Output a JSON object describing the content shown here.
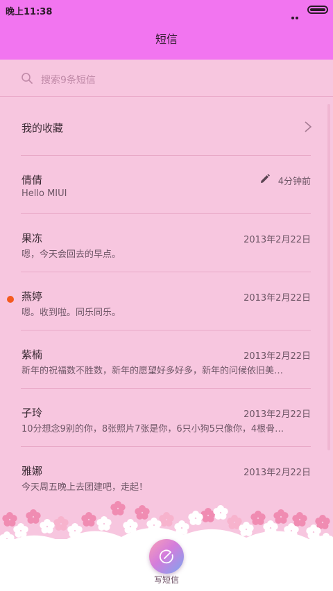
{
  "status_bar": {
    "time": "晚上11:38"
  },
  "header": {
    "title": "短信"
  },
  "search": {
    "placeholder": "搜索9条短信"
  },
  "favorites": {
    "label": "我的收藏"
  },
  "messages": [
    {
      "name": "倩倩",
      "preview": "Hello MIUI",
      "time": "4分钟前",
      "draft": true,
      "unread": false
    },
    {
      "name": "果冻",
      "preview": "嗯，今天会回去的早点。",
      "time": "2013年2月22日",
      "draft": false,
      "unread": false
    },
    {
      "name": "燕婷",
      "preview": "嗯。收到啦。同乐同乐。",
      "time": "2013年2月22日",
      "draft": false,
      "unread": true
    },
    {
      "name": "紫楠",
      "preview": "新年的祝福数不胜数，新年的愿望好多好多，新年的问候依旧美…",
      "time": "2013年2月22日",
      "draft": false,
      "unread": false
    },
    {
      "name": "子玲",
      "preview": "10分想念9别的你，8张照片7张是你，6只小狗5只像你，4根骨…",
      "time": "2013年2月22日",
      "draft": false,
      "unread": false
    },
    {
      "name": "雅娜",
      "preview": "今天周五晚上去团建吧，走起！",
      "time": "2013年2月22日",
      "draft": false,
      "unread": false
    }
  ],
  "compose": {
    "label": "写短信"
  },
  "colors": {
    "header_bg": "#f275f0",
    "body_bg": "#f7c6df",
    "unread": "#f45a1e"
  }
}
